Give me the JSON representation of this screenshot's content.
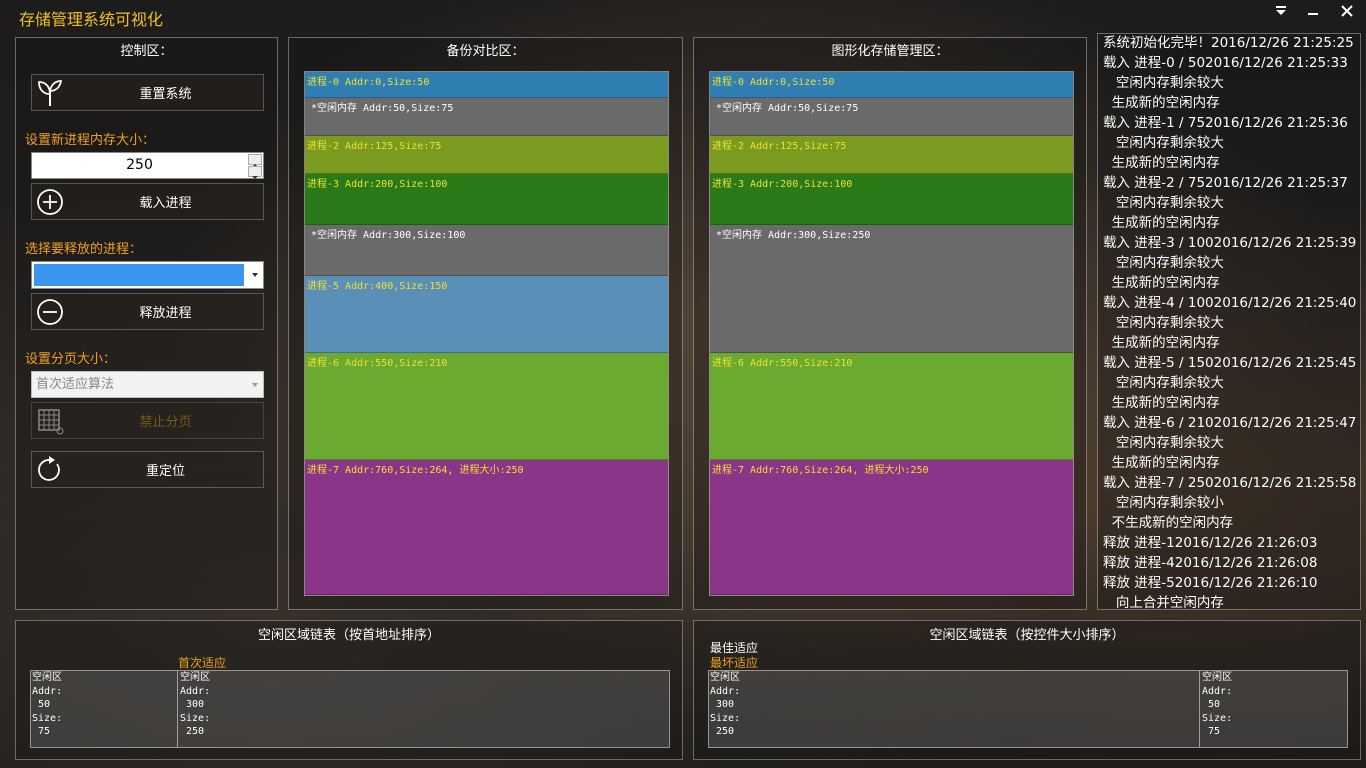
{
  "window": {
    "title": "存储管理系统可视化"
  },
  "control": {
    "title": "控制区：",
    "reset_label": "重置系统",
    "size_label": "设置新进程内存大小：",
    "size_value": "250",
    "load_label": "载入进程",
    "select_label": "选择要释放的进程：",
    "release_label": "释放进程",
    "page_label": "设置分页大小：",
    "algorithm_value": "首次适应算法",
    "stop_page_label": "禁止分页",
    "relocate_label": "重定位"
  },
  "backup": {
    "title": "备份对比区：",
    "blocks": [
      {
        "label": "进程-0  Addr:0,Size:50",
        "color": "#2f7fb3",
        "text_color": "#f0e030",
        "start": 0,
        "end": 50
      },
      {
        "label": "*空闲内存  Addr:50,Size:75",
        "color": "#6a6a6a",
        "text_color": "#ffffff",
        "start": 50,
        "end": 125
      },
      {
        "label": "进程-2  Addr:125,Size:75",
        "color": "#7a9a20",
        "text_color": "#f0e030",
        "start": 125,
        "end": 200
      },
      {
        "label": "进程-3  Addr:200,Size:100",
        "color": "#2a7a1a",
        "text_color": "#f0e030",
        "start": 200,
        "end": 300
      },
      {
        "label": "*空闲内存  Addr:300,Size:100",
        "color": "#6a6a6a",
        "text_color": "#ffffff",
        "start": 300,
        "end": 400
      },
      {
        "label": "进程-5  Addr:400,Size:150",
        "color": "#5a90b8",
        "text_color": "#f0e030",
        "start": 400,
        "end": 550
      },
      {
        "label": "进程-6  Addr:550,Size:210",
        "color": "#6aaa30",
        "text_color": "#f0e030",
        "start": 550,
        "end": 760
      },
      {
        "label": "进程-7  Addr:760,Size:264, 进程大小:250",
        "color": "#8a3588",
        "text_color": "#f0e030",
        "start": 760,
        "end": 1024
      }
    ]
  },
  "graphic": {
    "title": "图形化存储管理区：",
    "blocks": [
      {
        "label": "进程-0  Addr:0,Size:50",
        "color": "#2f7fb3",
        "text_color": "#f0e030",
        "start": 0,
        "end": 50
      },
      {
        "label": "*空闲内存  Addr:50,Size:75",
        "color": "#6a6a6a",
        "text_color": "#ffffff",
        "start": 50,
        "end": 125
      },
      {
        "label": "进程-2  Addr:125,Size:75",
        "color": "#7a9a20",
        "text_color": "#f0e030",
        "start": 125,
        "end": 200
      },
      {
        "label": "进程-3  Addr:200,Size:100",
        "color": "#2a7a1a",
        "text_color": "#f0e030",
        "start": 200,
        "end": 300
      },
      {
        "label": "*空闲内存  Addr:300,Size:250",
        "color": "#6a6a6a",
        "text_color": "#ffffff",
        "start": 300,
        "end": 550
      },
      {
        "label": "进程-6  Addr:550,Size:210",
        "color": "#6aaa30",
        "text_color": "#f0e030",
        "start": 550,
        "end": 760
      },
      {
        "label": "进程-7  Addr:760,Size:264, 进程大小:250",
        "color": "#8a3588",
        "text_color": "#f0e030",
        "start": 760,
        "end": 1024
      }
    ]
  },
  "log": {
    "lines": [
      "系统初始化完毕！2016/12/26 21:25:25",
      "载入 进程-0 / 502016/12/26 21:25:33",
      "   空闲内存剩余较大",
      "  生成新的空闲内存",
      "载入 进程-1 / 752016/12/26 21:25:36",
      "   空闲内存剩余较大",
      "  生成新的空闲内存",
      "载入 进程-2 / 752016/12/26 21:25:37",
      "   空闲内存剩余较大",
      "  生成新的空闲内存",
      "载入 进程-3 / 1002016/12/26 21:25:39",
      "   空闲内存剩余较大",
      "  生成新的空闲内存",
      "载入 进程-4 / 1002016/12/26 21:25:40",
      "   空闲内存剩余较大",
      "  生成新的空闲内存",
      "载入 进程-5 / 1502016/12/26 21:25:45",
      "   空闲内存剩余较大",
      "  生成新的空闲内存",
      "载入 进程-6 / 2102016/12/26 21:25:47",
      "   空闲内存剩余较大",
      "  生成新的空闲内存",
      "载入 进程-7 / 2502016/12/26 21:25:58",
      "   空闲内存剩余较小",
      "  不生成新的空闲内存",
      "释放 进程-12016/12/26 21:26:03",
      "释放 进程-42016/12/26 21:26:08",
      "释放 进程-52016/12/26 21:26:10",
      "   向上合并空闲内存"
    ]
  },
  "free_by_addr": {
    "title": "空闲区域链表（按首地址排序）",
    "hint": "首次适应",
    "items": [
      {
        "text": "空闲区\nAddr:\n 50\nSize:\n 75"
      },
      {
        "text": "空闲区\nAddr:\n 300\nSize:\n 250"
      }
    ]
  },
  "free_by_size": {
    "title": "空闲区域链表（按控件大小排序）",
    "hint_best": "最佳适应",
    "hint_worst": "最坏适应",
    "items": [
      {
        "text": "空闲区\nAddr:\n 300\nSize:\n 250"
      },
      {
        "text": "空闲区\nAddr:\n 50\nSize:\n 75"
      }
    ]
  },
  "colors": {
    "accent": "#f0a020",
    "title": "#f0c020",
    "select_fill": "#3a95f0"
  }
}
